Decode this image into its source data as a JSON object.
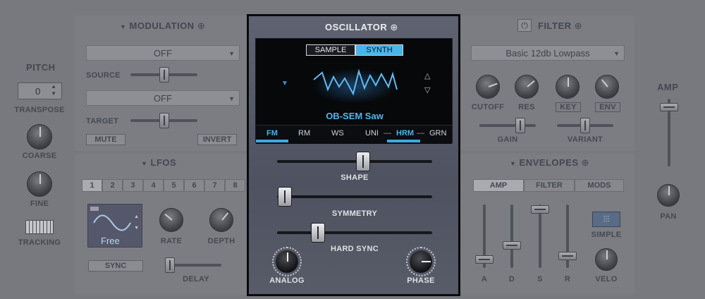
{
  "pitch": {
    "title": "PITCH",
    "transpose_value": "0",
    "transpose_label": "TRANSPOSE",
    "coarse_label": "COARSE",
    "fine_label": "FINE",
    "tracking_label": "TRACKING"
  },
  "modulation": {
    "title": "MODULATION",
    "source_value": "OFF",
    "source_label": "SOURCE",
    "target_value": "OFF",
    "target_label": "TARGET",
    "mute_label": "MUTE",
    "invert_label": "INVERT"
  },
  "lfos": {
    "title": "LFOS",
    "tabs": [
      "1",
      "2",
      "3",
      "4",
      "5",
      "6",
      "7",
      "8"
    ],
    "selected_tab": "1",
    "shape_name": "Free",
    "rate_label": "RATE",
    "depth_label": "DEPTH",
    "sync_label": "SYNC",
    "delay_label": "DELAY"
  },
  "oscillator": {
    "title": "OSCILLATOR",
    "mode_sample": "SAMPLE",
    "mode_synth": "SYNTH",
    "active_mode": "SYNTH",
    "waveform_name": "OB-SEM Saw",
    "tabs": {
      "fm": "FM",
      "rm": "RM",
      "ws": "WS",
      "uni": "UNI",
      "hrm": "HRM",
      "grn": "GRN"
    },
    "shape_label": "SHAPE",
    "symmetry_label": "SYMMETRY",
    "hard_sync_label": "HARD SYNC",
    "analog_label": "ANALOG",
    "phase_label": "PHASE",
    "shape_value": 0.55,
    "symmetry_value": 0.0,
    "hard_sync_value": 0.25
  },
  "filter": {
    "title": "FILTER",
    "type_value": "Basic 12db Lowpass",
    "cutoff_label": "CUTOFF",
    "res_label": "RES",
    "key_label": "KEY",
    "env_label": "ENV",
    "gain_label": "GAIN",
    "variant_label": "VARIANT"
  },
  "envelopes": {
    "title": "ENVELOPES",
    "tabs": [
      "AMP",
      "FILTER",
      "MODS"
    ],
    "active_tab": "AMP",
    "a_label": "A",
    "d_label": "D",
    "s_label": "S",
    "r_label": "R",
    "simple_label": "SIMPLE",
    "velo_label": "VELO"
  },
  "amp": {
    "title": "AMP",
    "pan_label": "PAN"
  },
  "colors": {
    "accent": "#3fa9e0",
    "waveform": "#58b5f0",
    "background": "#77797e"
  }
}
